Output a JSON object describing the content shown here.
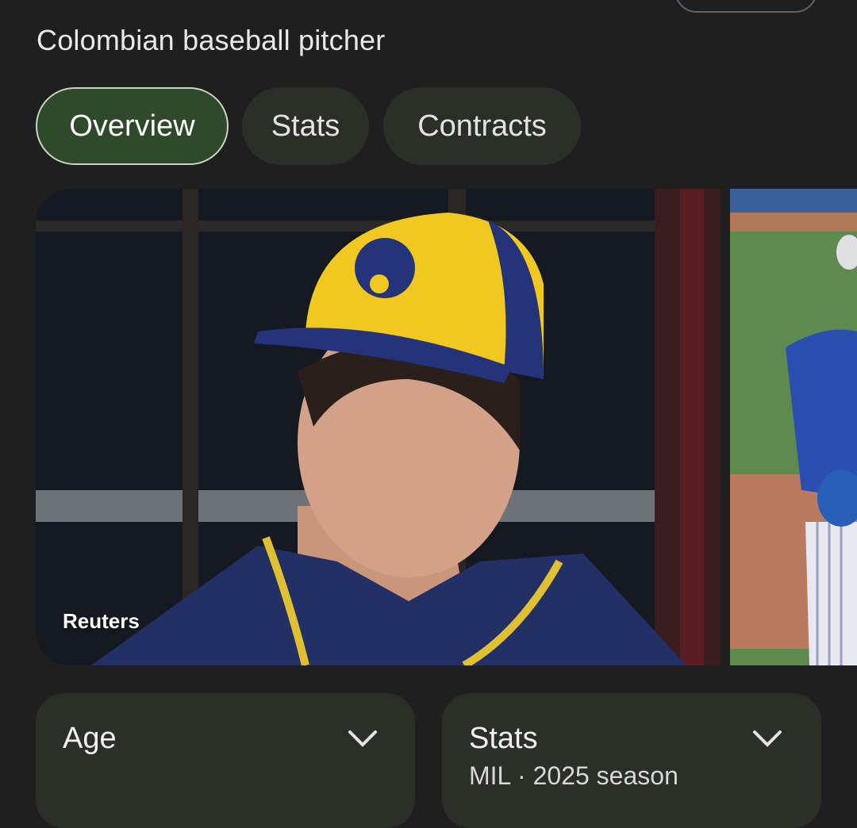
{
  "header": {
    "subtitle": "Colombian baseball pitcher"
  },
  "tabs": [
    {
      "label": "Overview",
      "active": true
    },
    {
      "label": "Stats",
      "active": false
    },
    {
      "label": "Contracts",
      "active": false
    }
  ],
  "images": {
    "main_credit": "Reuters",
    "main_icon": "player-photo",
    "side_icon": "player-photo"
  },
  "cards": {
    "age": {
      "title": "Age"
    },
    "stats": {
      "title": "Stats",
      "subtitle": "MIL · 2025 season"
    }
  },
  "colors": {
    "background": "#1f1f1f",
    "chip_active": "#2e4a2a",
    "chip": "#2c2f28",
    "card": "#2b2f28"
  }
}
